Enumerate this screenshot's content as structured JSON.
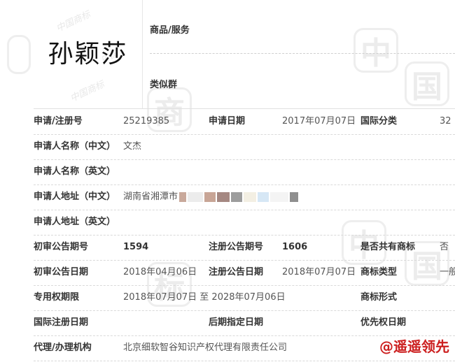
{
  "logo": {
    "text": "孙颖莎"
  },
  "top": {
    "goods_label": "商品/服务",
    "similar_label": "类似群"
  },
  "rows": {
    "reg_no_label": "申请/注册号",
    "reg_no": "25219385",
    "app_date_label": "申请日期",
    "app_date": "2017年07月07日",
    "intl_class_label": "国际分类",
    "intl_class": "32",
    "applicant_cn_label": "申请人名称（中文）",
    "applicant_cn": "文杰",
    "applicant_en_label": "申请人名称（英文）",
    "address_cn_label": "申请人地址（中文）",
    "address_cn": "湖南省湘潭市",
    "address_en_label": "申请人地址（英文）",
    "prelim_issue_label": "初审公告期号",
    "prelim_issue": "1594",
    "reg_issue_label": "注册公告期号",
    "reg_issue": "1606",
    "shared_label": "是否共有商标",
    "shared": "否",
    "prelim_date_label": "初审公告日期",
    "prelim_date": "2018年04月06日",
    "reg_date_label": "注册公告日期",
    "reg_date": "2018年07月07日",
    "type_label": "商标类型",
    "type": "一般",
    "validity_label": "专用权期限",
    "validity": "2018年07月07日 至 2028年07月06日",
    "form_label": "商标形式",
    "intl_reg_label": "国际注册日期",
    "late_date_label": "后期指定日期",
    "priority_label": "优先权日期",
    "agent_label": "代理/办理机构",
    "agent": "北京细软智谷知识产权代理有限责任公司"
  },
  "footer": {
    "watermark": "@遥遥领先"
  },
  "colors": {
    "arrow": "#f39c12",
    "footer": "#cc1f1f"
  }
}
